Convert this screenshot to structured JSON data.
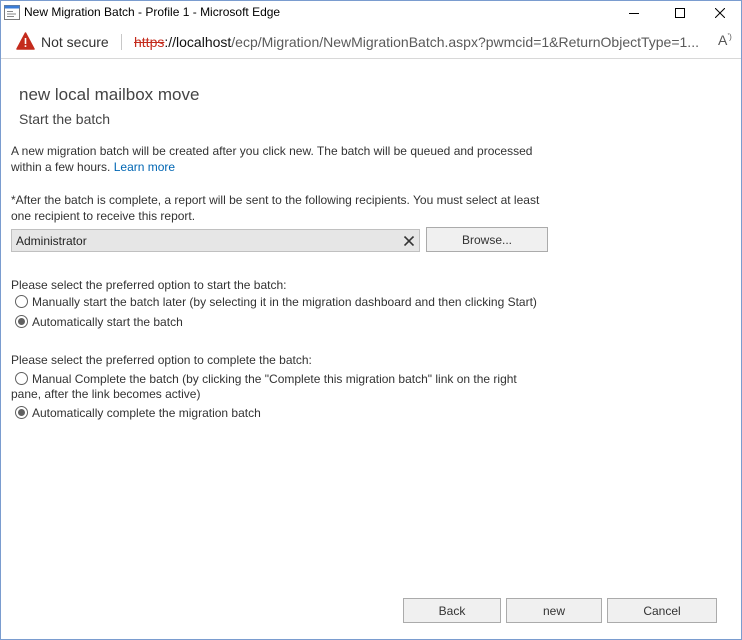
{
  "window": {
    "title": "New Migration Batch - Profile 1 - Microsoft Edge"
  },
  "addressbar": {
    "security_label": "Not secure",
    "url_scheme": "https",
    "url_host": "://localhost",
    "url_path": "/ecp/Migration/NewMigrationBatch.aspx?pwmcid=1&ReturnObjectType=1..."
  },
  "page": {
    "heading": "new local mailbox move",
    "subheading": "Start the batch",
    "intro_text": "A new migration batch will be created after you click new. The batch will be queued and processed within a few hours.",
    "learn_more": "Learn more",
    "report_text": "*After the batch is complete, a report will be sent to the following recipients. You must select at least one recipient to receive this report.",
    "recipient_value": "Administrator",
    "browse_label": "Browse...",
    "start_prompt": "Please select the preferred option to start the batch:",
    "start_options": [
      {
        "label": "Manually start the batch later (by selecting it in the migration dashboard and then clicking Start)",
        "selected": false
      },
      {
        "label": "Automatically start the batch",
        "selected": true
      }
    ],
    "complete_prompt": "Please select the preferred option to complete the batch:",
    "complete_options": [
      {
        "label_line1": "Manual Complete the batch (by clicking the \"Complete this migration batch\" link on the right",
        "label_line2": "pane, after the link becomes active)",
        "selected": false
      },
      {
        "label": "Automatically complete the migration batch",
        "selected": true
      }
    ]
  },
  "footer": {
    "back_label": "Back",
    "new_label": "new",
    "cancel_label": "Cancel"
  },
  "colors": {
    "link": "#0066b3",
    "warning": "#c42b1c",
    "window_border": "#7a9ccf"
  }
}
